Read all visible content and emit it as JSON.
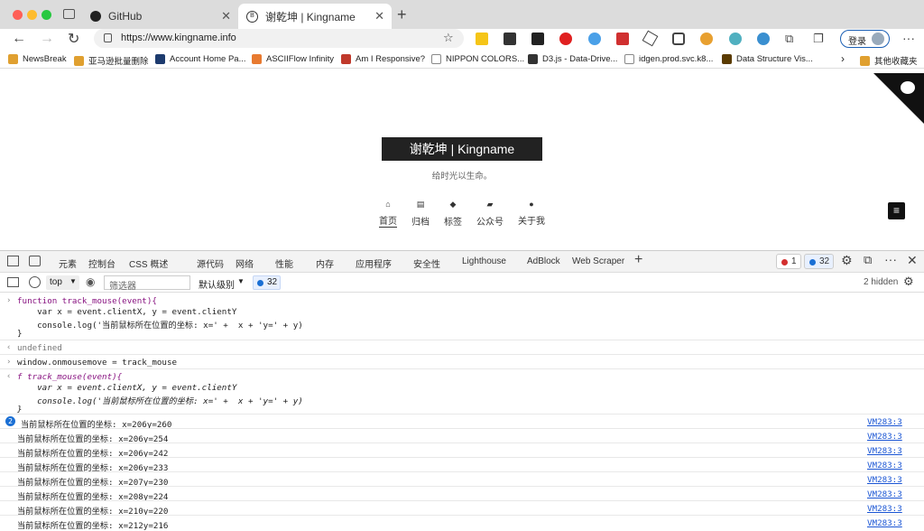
{
  "tabs": [
    {
      "label": "GitHub"
    },
    {
      "label": "谢乾坤 | Kingname"
    }
  ],
  "address": {
    "url": "https://www.kingname.info"
  },
  "profile": {
    "label": "登录"
  },
  "bookmarks": [
    {
      "label": "NewsBreak",
      "color": "#e0a030"
    },
    {
      "label": "亚马逊批量删除",
      "color": "#e0a030"
    },
    {
      "label": "Account Home Pa...",
      "color": "#1d3b6e"
    },
    {
      "label": "ASCIIFlow Infinity",
      "color": "#e87a30"
    },
    {
      "label": "Am I Responsive?",
      "color": "#c0392b"
    },
    {
      "label": "NIPPON COLORS...",
      "color": "#888888"
    },
    {
      "label": "D3.js - Data-Drive...",
      "color": "#333333"
    },
    {
      "label": "idgen.prod.svc.k8...",
      "color": "#888888"
    },
    {
      "label": "Data Structure Vis...",
      "color": "#5a3b00"
    }
  ],
  "bookmark_folder": "其他收藏夹",
  "page": {
    "site_title": "谢乾坤 | Kingname",
    "subtitle": "给时光以生命。",
    "nav": [
      {
        "label": "首页"
      },
      {
        "label": "归档"
      },
      {
        "label": "标签"
      },
      {
        "label": "公众号"
      },
      {
        "label": "关于我"
      }
    ]
  },
  "devtools": {
    "tabs": [
      "元素",
      "控制台",
      "CSS 概述",
      "源代码",
      "网络",
      "性能",
      "内存",
      "应用程序",
      "安全性",
      "Lighthouse",
      "AdBlock",
      "Web Scraper"
    ],
    "errors": "1",
    "messages": "32",
    "context": "top",
    "filter_placeholder": "筛选器",
    "levels": "默认级别",
    "msg_count": "32",
    "hidden": "2 hidden"
  },
  "console": {
    "code1": [
      "function track_mouse(event){",
      "    var x = event.clientX, y = event.clientY",
      "    console.log('当前鼠标所在位置的坐标: x=' +  x + 'y=' + y)",
      "}"
    ],
    "undefined": "undefined",
    "assign": "window.onmousemove = track_mouse",
    "echo": [
      "f track_mouse(event){",
      "    var x = event.clientX, y = event.clientY",
      "    console.log('当前鼠标所在位置的坐标: x=' +  x + 'y=' + y)",
      "}"
    ],
    "repeat_count": "2",
    "logs": [
      {
        "text": "当前鼠标所在位置的坐标: x=206y=260",
        "src": "VM283:3"
      },
      {
        "text": "当前鼠标所在位置的坐标: x=206y=254",
        "src": "VM283:3"
      },
      {
        "text": "当前鼠标所在位置的坐标: x=206y=242",
        "src": "VM283:3"
      },
      {
        "text": "当前鼠标所在位置的坐标: x=206y=233",
        "src": "VM283:3"
      },
      {
        "text": "当前鼠标所在位置的坐标: x=207y=230",
        "src": "VM283:3"
      },
      {
        "text": "当前鼠标所在位置的坐标: x=208y=224",
        "src": "VM283:3"
      },
      {
        "text": "当前鼠标所在位置的坐标: x=210y=220",
        "src": "VM283:3"
      },
      {
        "text": "当前鼠标所在位置的坐标: x=212y=216",
        "src": "VM283:3"
      }
    ]
  }
}
